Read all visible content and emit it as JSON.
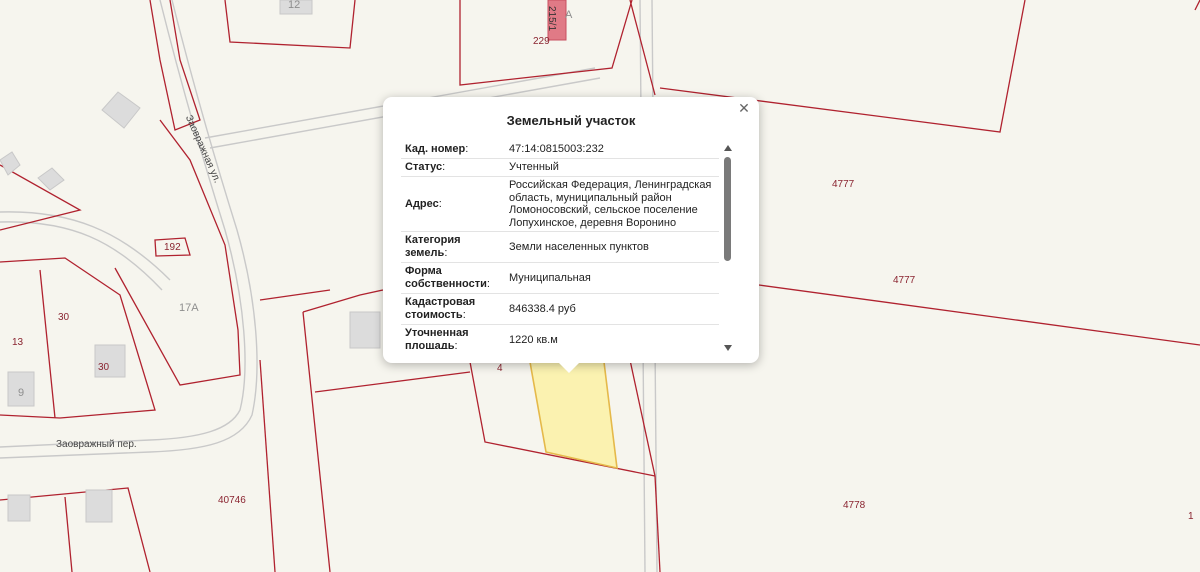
{
  "map": {
    "parcel_labels": [
      "12",
      "229",
      "192",
      "17А",
      "13",
      "30",
      "30",
      "9",
      "40746",
      "4777",
      "4777",
      "4778",
      "4",
      "А",
      "1"
    ],
    "house_labels": [
      "215/1"
    ],
    "streets": {
      "zaovr_ul": "Заовражная ул.",
      "zaovr_per": "Заовражный пер."
    },
    "colors": {
      "background": "#f6f5ee",
      "boundary": "#b0222f",
      "road": "#c9c9c9",
      "building": "#dcdcdc",
      "selected_fill": "#fbf2b0",
      "selected_stroke": "#e5b94a",
      "highlight_building": "#e07a86"
    }
  },
  "popup": {
    "title": "Земельный участок",
    "close_icon": "close-icon",
    "rows": [
      {
        "key": "Кад. номер",
        "value": "47:14:0815003:232"
      },
      {
        "key": "Статус",
        "value": "Учтенный"
      },
      {
        "key": "Адрес",
        "value": "Российская Федерация, Ленинградская область, муниципальный район Ломоносовский, сельское поселение Лопухинское, деревня Воронино"
      },
      {
        "key": "Категория земель",
        "value": "Земли населенных пунктов"
      },
      {
        "key": "Форма собственности",
        "value": "Муниципальная"
      },
      {
        "key": "Кадастровая стоимость",
        "value": "846338.4 руб"
      },
      {
        "key": "Уточненная площадь",
        "value": "1220 кв.м"
      }
    ]
  }
}
